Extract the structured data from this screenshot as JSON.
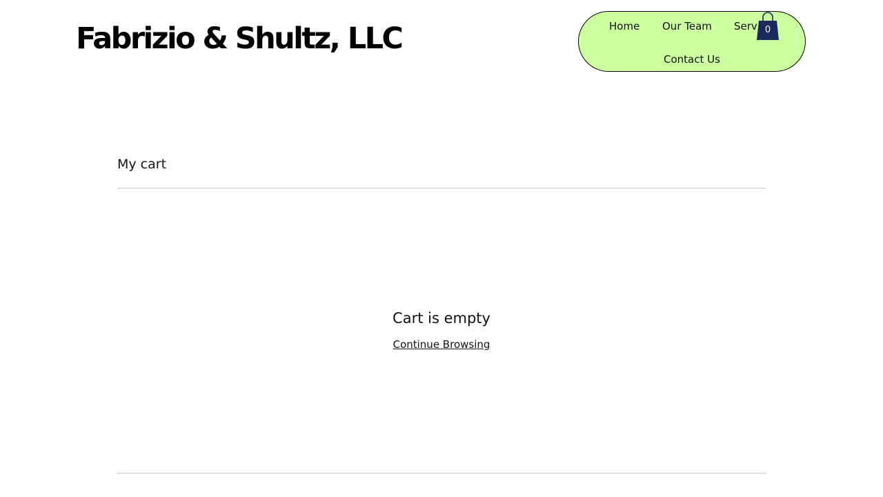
{
  "header": {
    "site_title": "Fabrizio & Shultz, LLC",
    "nav": {
      "home": "Home",
      "our_team": "Our Team",
      "services": "Services",
      "contact_us": "Contact Us"
    },
    "cart": {
      "icon": "shopping-bag-icon",
      "count": "0"
    }
  },
  "cart_page": {
    "heading": "My cart",
    "empty_message": "Cart is empty",
    "continue_link": "Continue Browsing"
  },
  "colors": {
    "nav_background": "#ccff9f",
    "cart_icon": "#1b2a5c",
    "divider": "#c8c8c8"
  }
}
